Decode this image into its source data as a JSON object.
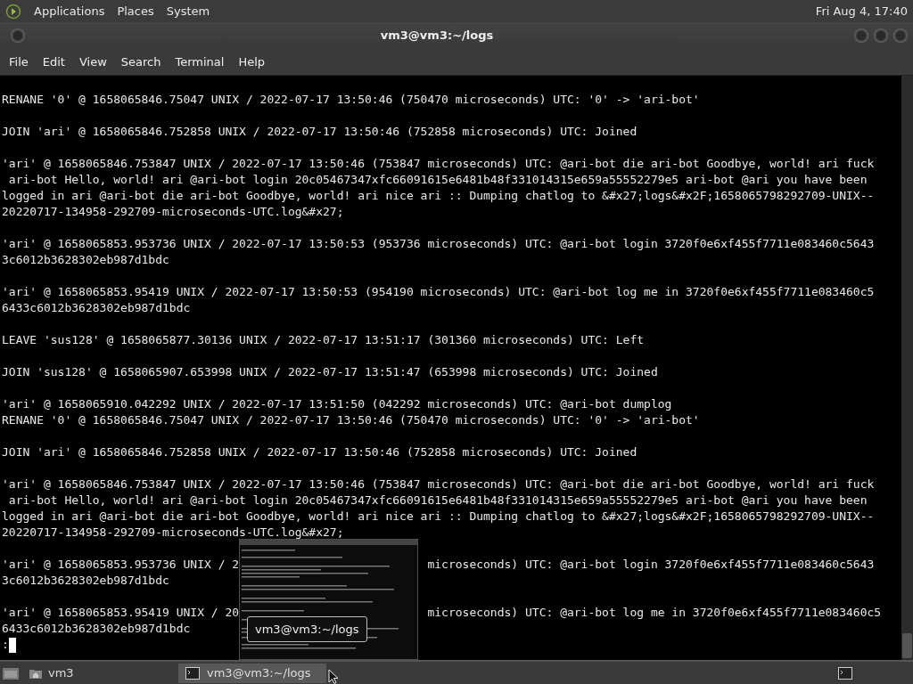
{
  "top_panel": {
    "menus": [
      "Applications",
      "Places",
      "System"
    ],
    "clock": "Fri Aug 4, 17:40"
  },
  "window": {
    "title": "vm3@vm3:~/logs"
  },
  "menu_bar": [
    "File",
    "Edit",
    "View",
    "Search",
    "Terminal",
    "Help"
  ],
  "terminal": {
    "paragraphs": [
      [
        "RENANE '0' @ 1658065846.75047 UNIX / 2022-07-17 13:50:46 (750470 microseconds) UTC: '0' -> 'ari-bot'"
      ],
      [
        "JOIN 'ari' @ 1658065846.752858 UNIX / 2022-07-17 13:50:46 (752858 microseconds) UTC: Joined"
      ],
      [
        "'ari' @ 1658065846.753847 UNIX / 2022-07-17 13:50:46 (753847 microseconds) UTC: @ari-bot die ari-bot Goodbye, world! ari fuck",
        " ari-bot Hello, world! ari @ari-bot login 20c05467347xfc66091615e6481b48f331014315e659a55552279e5 ari-bot @ari you have been",
        "logged in ari @ari-bot die ari-bot Goodbye, world! ari nice ari :: Dumping chatlog to &#x27;logs&#x2F;1658065798292709-UNIX--",
        "20220717-134958-292709-microseconds-UTC.log&#x27;"
      ],
      [
        "'ari' @ 1658065853.953736 UNIX / 2022-07-17 13:50:53 (953736 microseconds) UTC: @ari-bot login 3720f0e6xf455f7711e083460c5643",
        "3c6012b3628302eb987d1bdc"
      ],
      [
        "'ari' @ 1658065853.95419 UNIX / 2022-07-17 13:50:53 (954190 microseconds) UTC: @ari-bot log me in 3720f0e6xf455f7711e083460c5",
        "6433c6012b3628302eb987d1bdc"
      ],
      [
        "LEAVE 'sus128' @ 1658065877.30136 UNIX / 2022-07-17 13:51:17 (301360 microseconds) UTC: Left"
      ],
      [
        "JOIN 'sus128' @ 1658065907.653998 UNIX / 2022-07-17 13:51:47 (653998 microseconds) UTC: Joined"
      ],
      [
        "'ari' @ 1658065910.042292 UNIX / 2022-07-17 13:51:50 (042292 microseconds) UTC: @ari-bot dumplog",
        "RENANE '0' @ 1658065846.75047 UNIX / 2022-07-17 13:50:46 (750470 microseconds) UTC: '0' -> 'ari-bot'"
      ],
      [
        "JOIN 'ari' @ 1658065846.752858 UNIX / 2022-07-17 13:50:46 (752858 microseconds) UTC: Joined"
      ],
      [
        "'ari' @ 1658065846.753847 UNIX / 2022-07-17 13:50:46 (753847 microseconds) UTC: @ari-bot die ari-bot Goodbye, world! ari fuck",
        " ari-bot Hello, world! ari @ari-bot login 20c05467347xfc66091615e6481b48f331014315e659a55552279e5 ari-bot @ari you have been",
        "logged in ari @ari-bot die ari-bot Goodbye, world! ari nice ari :: Dumping chatlog to &#x27;logs&#x2F;1658065798292709-UNIX--",
        "20220717-134958-292709-microseconds-UTC.log&#x27;"
      ],
      [
        {
          "before_cover": "'ari' @ 1658065853.953736 UNIX / 2",
          "after_cover": "microseconds) UTC: @ari-bot login 3720f0e6xf455f7711e083460c5643"
        },
        "3c6012b3628302eb987d1bdc"
      ],
      [
        {
          "before_cover": "'ari' @ 1658065853.95419 UNIX / 20",
          "after_cover": "microseconds) UTC: @ari-bot log me in 3720f0e6xf455f7711e083460c5"
        },
        "6433c6012b3628302eb987d1bdc"
      ]
    ],
    "prompt": ":"
  },
  "preview_tooltip": {
    "title": "vm3@vm3:~/logs"
  },
  "taskbar": {
    "places": [
      {
        "label": "vm3"
      }
    ],
    "tasks": [
      {
        "label": "vm3@vm3:~/logs",
        "selected": true
      }
    ]
  }
}
